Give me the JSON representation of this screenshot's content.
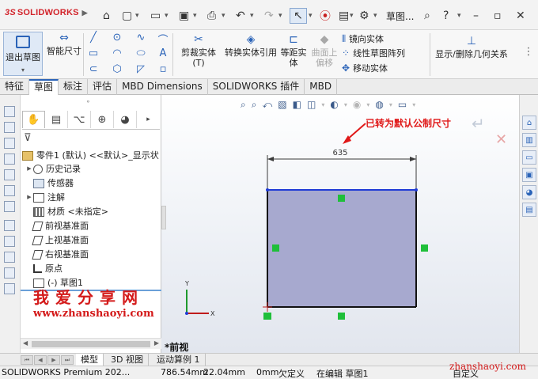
{
  "app": {
    "logo": "SOLIDWORKS",
    "file_title": "草图..."
  },
  "command_manager": {
    "exit_sketch": "退出草图",
    "smart_dimension": "智能尺寸",
    "trim_entities": "剪裁实体(T)",
    "convert_entities": "转换实体引用",
    "offset_entities": "等距实体",
    "offset_on_surface": "曲面上偏移",
    "mirror_entities": "镜向实体",
    "linear_pattern": "线性草图阵列",
    "move_entities": "移动实体",
    "display_delete_relations": "显示/删除几何关系"
  },
  "tabs": [
    "特征",
    "草图",
    "标注",
    "评估",
    "MBD Dimensions",
    "SOLIDWORKS 插件",
    "MBD"
  ],
  "active_tab": "草图",
  "feature_tree": {
    "root": "零件1 (默认) <<默认>_显示状",
    "items": [
      {
        "label": "历史记录",
        "icon": "history-icon",
        "expandable": true
      },
      {
        "label": "传感器",
        "icon": "sensor-icon",
        "expandable": false
      },
      {
        "label": "注解",
        "icon": "annotation-icon",
        "expandable": true
      },
      {
        "label": "材质 <未指定>",
        "icon": "material-icon",
        "expandable": false
      },
      {
        "label": "前视基准面",
        "icon": "plane-icon",
        "expandable": false
      },
      {
        "label": "上视基准面",
        "icon": "plane-icon",
        "expandable": false
      },
      {
        "label": "右视基准面",
        "icon": "plane-icon",
        "expandable": false
      },
      {
        "label": "原点",
        "icon": "origin-icon",
        "expandable": false
      },
      {
        "label": "(-) 草图1",
        "icon": "sketch-icon",
        "expandable": false
      }
    ]
  },
  "watermark": {
    "cn": "我爱分享网",
    "url": "www.zhanshaoyi.com",
    "url_br": "zhanshaoyi.com"
  },
  "graphics": {
    "annotation": "已转为默认公制尺寸",
    "dimension_value": "635",
    "view_label": "*前视",
    "triad_y": "Y",
    "triad_x": "X",
    "colors": {
      "rect_fill": "#a7a9cf",
      "top_edge": "#1f3bd6",
      "annotation": "#e01818",
      "relation_marker": "#1fbf3a"
    }
  },
  "bottom_tabs": [
    "模型",
    "3D 视图",
    "运动算例 1"
  ],
  "active_bottom_tab": "模型",
  "status_bar": {
    "product": "SOLIDWORKS Premium 202...",
    "x": "786.54mm",
    "y": "22.04mm",
    "z": "0mm",
    "state": "欠定义",
    "mode": "在编辑 草图1",
    "custom": "自定义"
  }
}
